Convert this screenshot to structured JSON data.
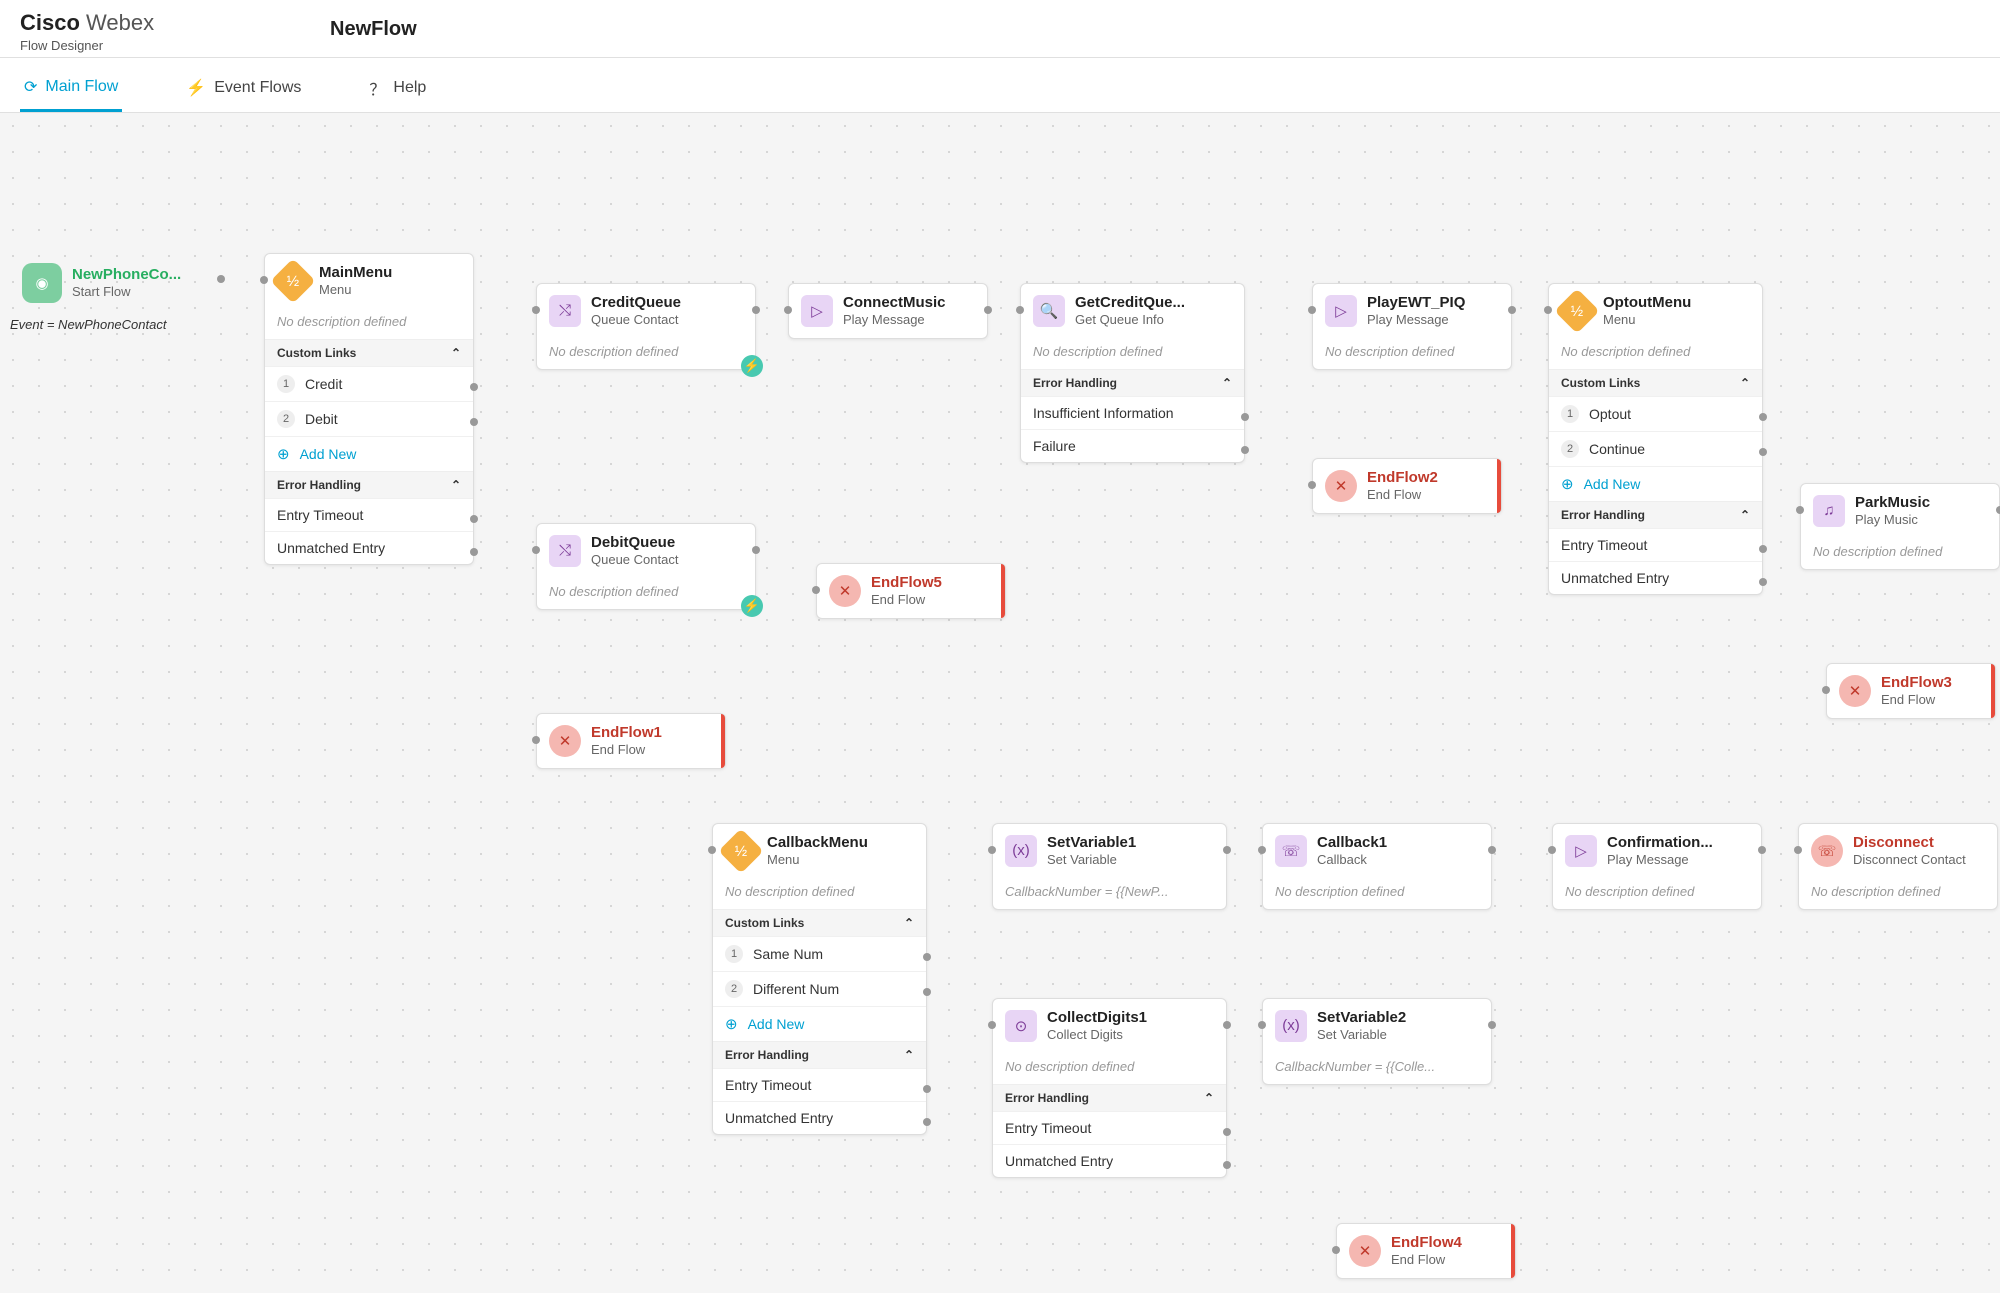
{
  "header": {
    "brand1": "Cisco",
    "brand2": "Webex",
    "sub": "Flow Designer",
    "flowname": "NewFlow"
  },
  "tabs": {
    "main": "Main Flow",
    "events": "Event Flows",
    "help": "Help"
  },
  "start": {
    "title": "NewPhoneCo...",
    "sub": "Start Flow",
    "event": "Event = NewPhoneContact"
  },
  "mainmenu": {
    "title": "MainMenu",
    "sub": "Menu",
    "desc": "No description defined",
    "sec1": "Custom Links",
    "opt1": "Credit",
    "opt2": "Debit",
    "add": "Add New",
    "sec2": "Error Handling",
    "err1": "Entry Timeout",
    "err2": "Unmatched Entry"
  },
  "creditq": {
    "title": "CreditQueue",
    "sub": "Queue Contact",
    "desc": "No description defined"
  },
  "debitq": {
    "title": "DebitQueue",
    "sub": "Queue Contact",
    "desc": "No description defined"
  },
  "endflow1": {
    "title": "EndFlow1",
    "sub": "End Flow"
  },
  "endflow5": {
    "title": "EndFlow5",
    "sub": "End Flow"
  },
  "connectmusic": {
    "title": "ConnectMusic",
    "sub": "Play Message"
  },
  "getcredit": {
    "title": "GetCreditQue...",
    "sub": "Get Queue Info",
    "desc": "No description defined",
    "sec": "Error Handling",
    "e1": "Insufficient Information",
    "e2": "Failure"
  },
  "playewt": {
    "title": "PlayEWT_PIQ",
    "sub": "Play Message",
    "desc": "No description defined"
  },
  "endflow2": {
    "title": "EndFlow2",
    "sub": "End Flow"
  },
  "optout": {
    "title": "OptoutMenu",
    "sub": "Menu",
    "desc": "No description defined",
    "sec1": "Custom Links",
    "o1": "Optout",
    "o2": "Continue",
    "add": "Add New",
    "sec2": "Error Handling",
    "e1": "Entry Timeout",
    "e2": "Unmatched Entry"
  },
  "parkmusic": {
    "title": "ParkMusic",
    "sub": "Play Music",
    "desc": "No description defined"
  },
  "endflow3": {
    "title": "EndFlow3",
    "sub": "End Flow"
  },
  "cbmenu": {
    "title": "CallbackMenu",
    "sub": "Menu",
    "desc": "No description defined",
    "sec1": "Custom Links",
    "o1": "Same Num",
    "o2": "Different Num",
    "add": "Add New",
    "sec2": "Error Handling",
    "e1": "Entry Timeout",
    "e2": "Unmatched Entry"
  },
  "setvar1": {
    "title": "SetVariable1",
    "sub": "Set Variable",
    "expr": "CallbackNumber = {{NewP..."
  },
  "collect": {
    "title": "CollectDigits1",
    "sub": "Collect Digits",
    "desc": "No description defined",
    "sec": "Error Handling",
    "e1": "Entry Timeout",
    "e2": "Unmatched Entry"
  },
  "setvar2": {
    "title": "SetVariable2",
    "sub": "Set Variable",
    "expr": "CallbackNumber = {{Colle..."
  },
  "callback1": {
    "title": "Callback1",
    "sub": "Callback",
    "desc": "No description defined"
  },
  "confirm": {
    "title": "Confirmation...",
    "sub": "Play Message",
    "desc": "No description defined"
  },
  "disconnect": {
    "title": "Disconnect",
    "sub": "Disconnect Contact",
    "desc": "No description defined"
  },
  "endflow4": {
    "title": "EndFlow4",
    "sub": "End Flow"
  },
  "chev": "⌃"
}
